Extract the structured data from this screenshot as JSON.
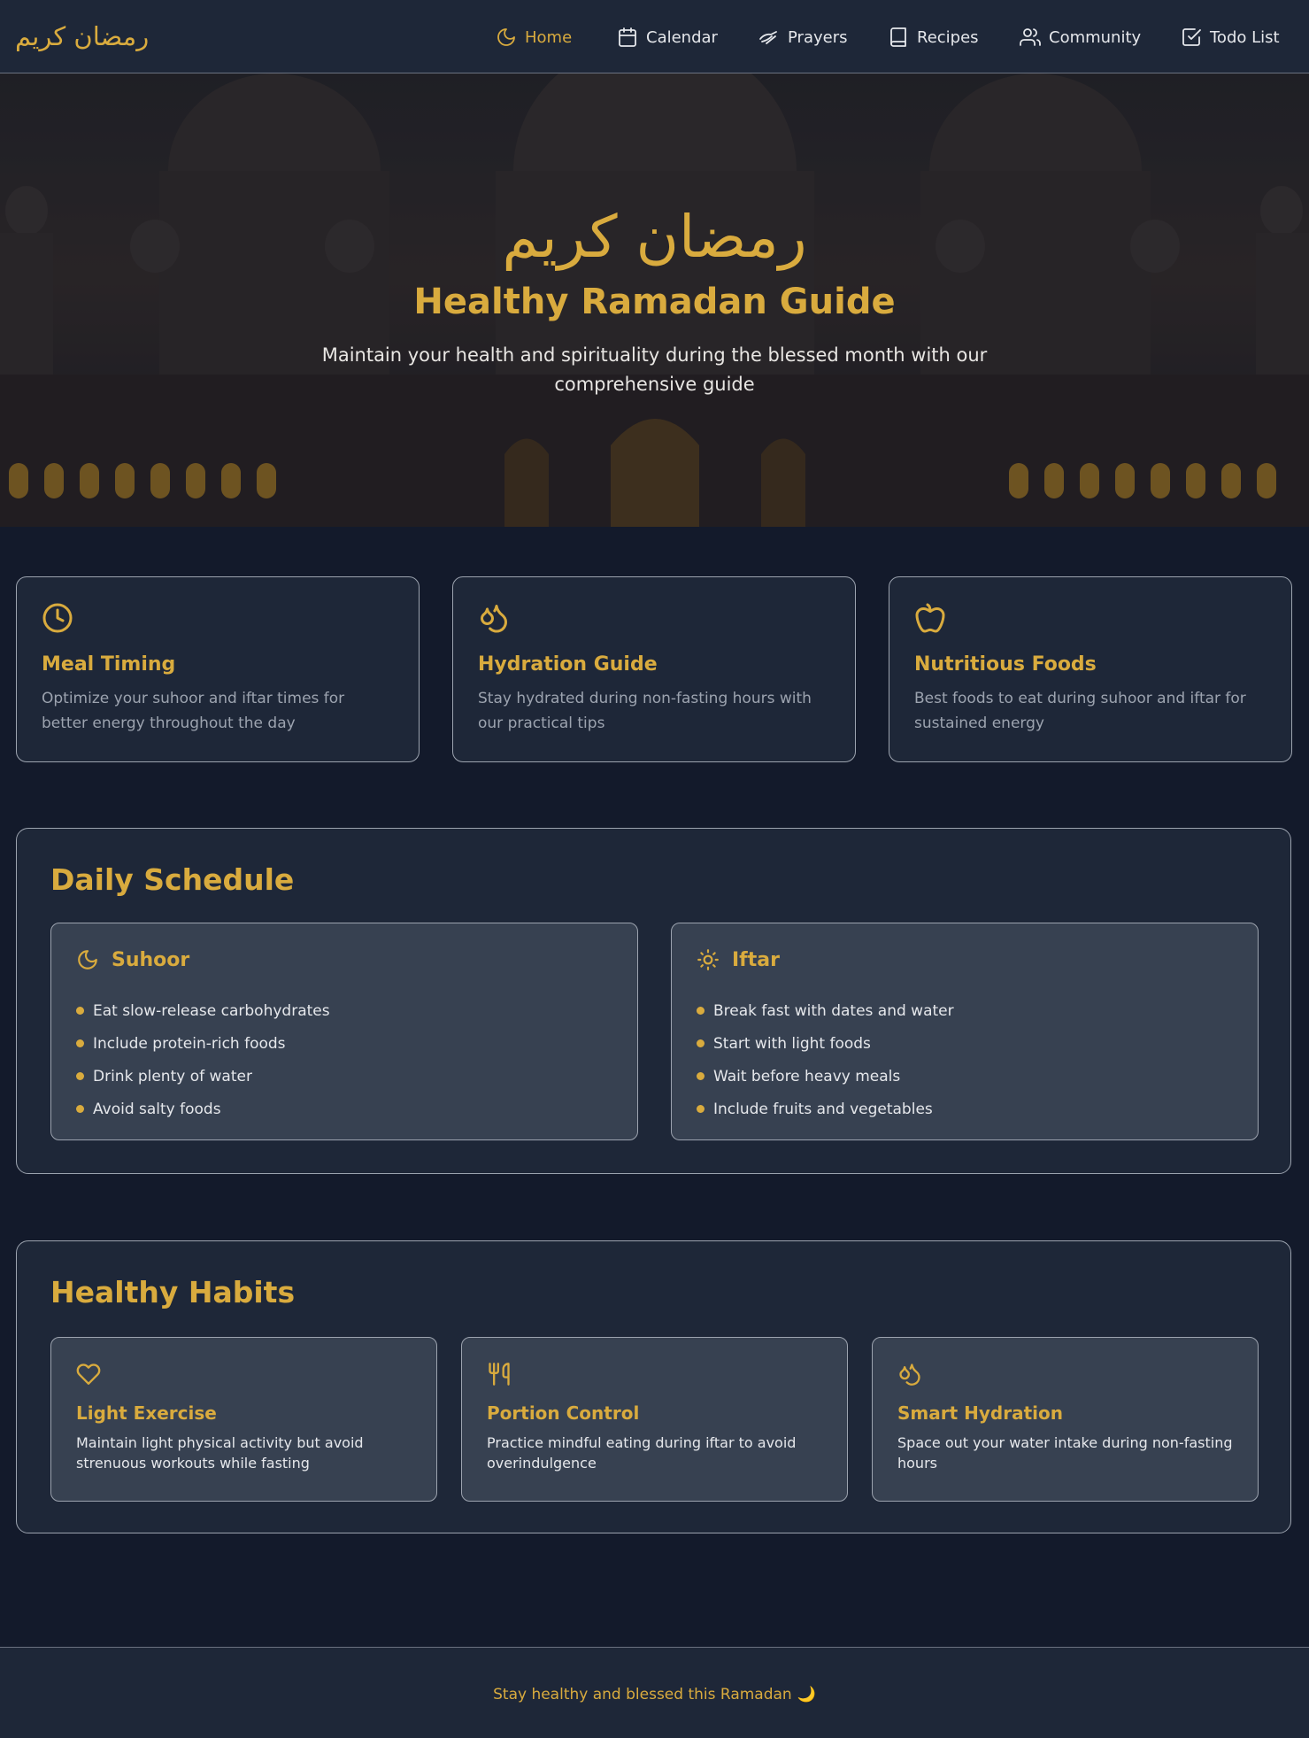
{
  "nav": {
    "brand": "رمضان كريم",
    "items": [
      {
        "label": "Home",
        "icon": "moon-icon",
        "active": true
      },
      {
        "label": "Calendar",
        "icon": "calendar-icon"
      },
      {
        "label": "Prayers",
        "icon": "hands-icon"
      },
      {
        "label": "Recipes",
        "icon": "book-icon"
      },
      {
        "label": "Community",
        "icon": "users-icon"
      },
      {
        "label": "Todo List",
        "icon": "checkbox-icon"
      }
    ]
  },
  "hero": {
    "arabic": "رمضان كريم",
    "title": "Healthy Ramadan Guide",
    "subtitle": "Maintain your health and spirituality during the blessed month with our comprehensive guide"
  },
  "features": [
    {
      "icon": "clock-icon",
      "title": "Meal Timing",
      "text": "Optimize your suhoor and iftar times for better energy throughout the day"
    },
    {
      "icon": "droplets-icon",
      "title": "Hydration Guide",
      "text": "Stay hydrated during non-fasting hours with our practical tips"
    },
    {
      "icon": "apple-icon",
      "title": "Nutritious Foods",
      "text": "Best foods to eat during suhoor and iftar for sustained energy"
    }
  ],
  "schedule": {
    "title": "Daily Schedule",
    "suhoor": {
      "title": "Suhoor",
      "items": [
        "Eat slow-release carbohydrates",
        "Include protein-rich foods",
        "Drink plenty of water",
        "Avoid salty foods"
      ]
    },
    "iftar": {
      "title": "Iftar",
      "items": [
        "Break fast with dates and water",
        "Start with light foods",
        "Wait before heavy meals",
        "Include fruits and vegetables"
      ]
    }
  },
  "habits": {
    "title": "Healthy Habits",
    "items": [
      {
        "icon": "heart-icon",
        "title": "Light Exercise",
        "text": "Maintain light physical activity but avoid strenuous workouts while fasting"
      },
      {
        "icon": "utensils-icon",
        "title": "Portion Control",
        "text": "Practice mindful eating during iftar to avoid overindulgence"
      },
      {
        "icon": "droplets-icon",
        "title": "Smart Hydration",
        "text": "Space out your water intake during non-fasting hours"
      }
    ]
  },
  "footer": {
    "text": "Stay healthy and blessed this Ramadan",
    "emoji": "🌙"
  },
  "colors": {
    "accent": "#d9ab3e",
    "background": "#131a2b",
    "card": "#1e2738",
    "inner_card": "#374151"
  }
}
